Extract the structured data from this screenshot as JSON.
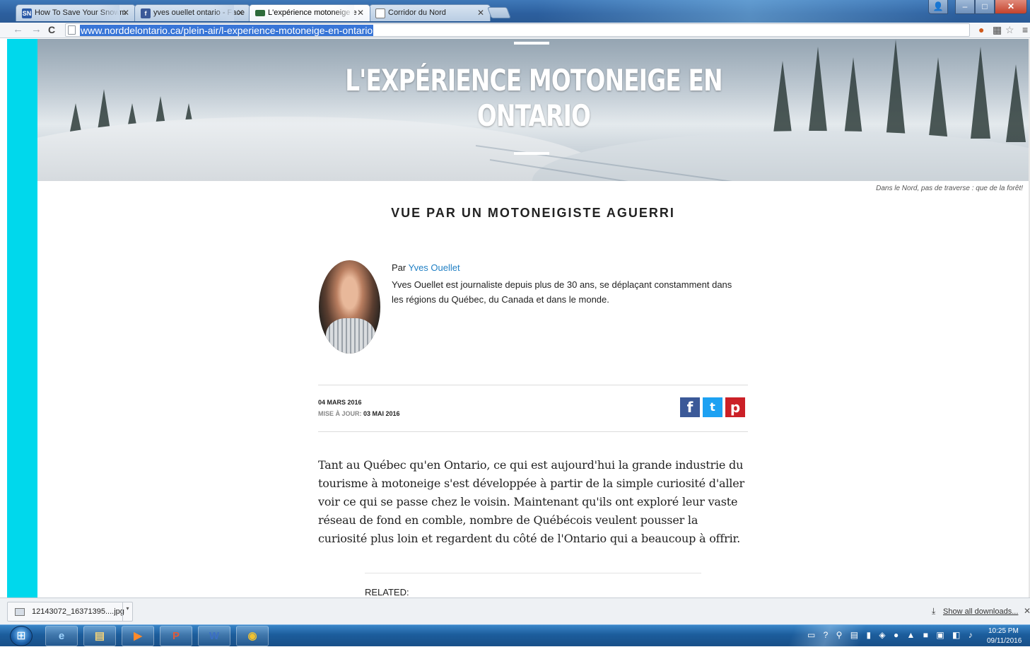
{
  "browser": {
    "tabs": [
      {
        "label": "How To Save Your Snowm",
        "favicon": "SN",
        "favicon_color": "#2b5aa8"
      },
      {
        "label": "yves ouellet ontario - Face",
        "favicon": "f",
        "favicon_color": "#3b5998"
      },
      {
        "label": "L'expérience motoneige e",
        "favicon": "",
        "favicon_color": "#2e6b3a"
      },
      {
        "label": "Corridor du Nord",
        "favicon": "",
        "favicon_color": "#ffffff"
      }
    ],
    "url": "www.norddelontario.ca/plein-air/l-experience-motoneige-en-ontario"
  },
  "article": {
    "title_line1": "L'EXPÉRIENCE MOTONEIGE EN",
    "title_line2": "ONTARIO",
    "image_caption": "Dans le Nord, pas de traverse : que de la forêt!",
    "subtitle": "VUE PAR UN MOTONEIGISTE AGUERRI",
    "by_prefix": "Par",
    "author": "Yves Ouellet",
    "author_bio": "Yves Ouellet est journaliste depuis plus de 30 ans, se déplaçant constamment dans les régions du Québec, du Canada et dans le monde.",
    "date": "04 MARS 2016",
    "updated_label": "MISE À JOUR:",
    "updated_date": "03 MAI 2016",
    "share": {
      "facebook": "f",
      "twitter": "t",
      "pinterest": "p"
    },
    "body": "Tant au Québec qu'en Ontario, ce qui est aujourd'hui la grande industrie du tourisme à motoneige s'est développée à partir de la simple curiosité d'aller voir ce qui se passe chez le voisin. Maintenant qu'ils ont exploré leur vaste réseau de fond en comble, nombre de Québécois veulent pousser la curiosité plus loin et regardent du côté de l'Ontario qui a beaucoup à offrir.",
    "related_label": "RELATED:"
  },
  "downloads": {
    "file_name": "12143072_16371395....jpg",
    "show_all": "Show all downloads..."
  },
  "taskbar": {
    "time": "10:25 PM",
    "date": "09/11/2016"
  },
  "colors": {
    "accent_cyan": "#00d8ec",
    "link": "#1f7fc4",
    "facebook": "#3b5998",
    "twitter": "#1da1f2",
    "pinterest": "#cb2027"
  }
}
